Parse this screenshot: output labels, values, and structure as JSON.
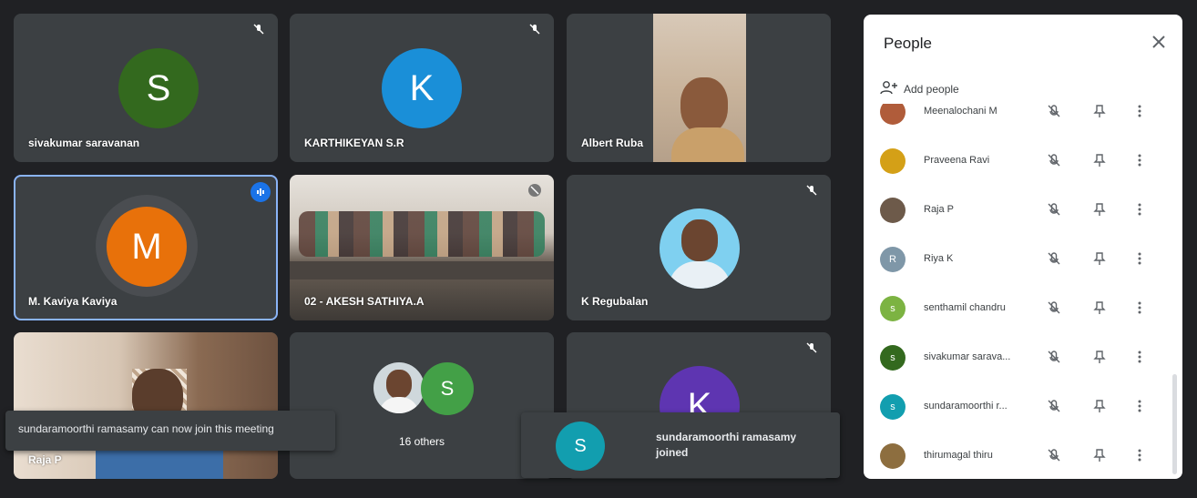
{
  "tiles": {
    "sivakumar": {
      "name": "sivakumar saravanan",
      "initial": "S",
      "color": "#33691e"
    },
    "karthikeyan": {
      "name": "KARTHIKEYAN S.R",
      "initial": "K",
      "color": "#1a8fd8"
    },
    "albert": {
      "name": "Albert Ruba"
    },
    "kaviya": {
      "name": "M. Kaviya Kaviya",
      "initial": "M",
      "color": "#e8710a"
    },
    "akesh": {
      "name": "02 - AKESH SATHIYA.A"
    },
    "regubalan": {
      "name": "K Regubalan"
    },
    "raja": {
      "name": "Raja P"
    },
    "others": {
      "label": "16 others",
      "initial": "S",
      "color": "#43a047"
    },
    "k_tile": {
      "initial": "K",
      "color": "#5e35b1"
    }
  },
  "toasts": {
    "join_permission": "sundaramoorthi ramasamy can now join this meeting",
    "joined": {
      "initial": "S",
      "color": "#129eaf",
      "text": "sundaramoorthi ramasamy joined"
    }
  },
  "people_panel": {
    "title": "People",
    "add_people": "Add people",
    "participants": [
      {
        "name": "Meenalochani M",
        "initial": "",
        "color": "#b05c3a"
      },
      {
        "name": "Praveena Ravi",
        "initial": "",
        "color": "#d4a017"
      },
      {
        "name": "Raja P",
        "initial": "",
        "color": "#6d5a4a"
      },
      {
        "name": "Riya K",
        "initial": "R",
        "color": "#7f97a8"
      },
      {
        "name": "senthamil chandru",
        "initial": "s",
        "color": "#7cb342"
      },
      {
        "name": "sivakumar sarava...",
        "initial": "s",
        "color": "#33691e"
      },
      {
        "name": "sundaramoorthi r...",
        "initial": "s",
        "color": "#129eaf"
      },
      {
        "name": "thirumagal thiru",
        "initial": "",
        "color": "#8d6e3f"
      }
    ]
  }
}
